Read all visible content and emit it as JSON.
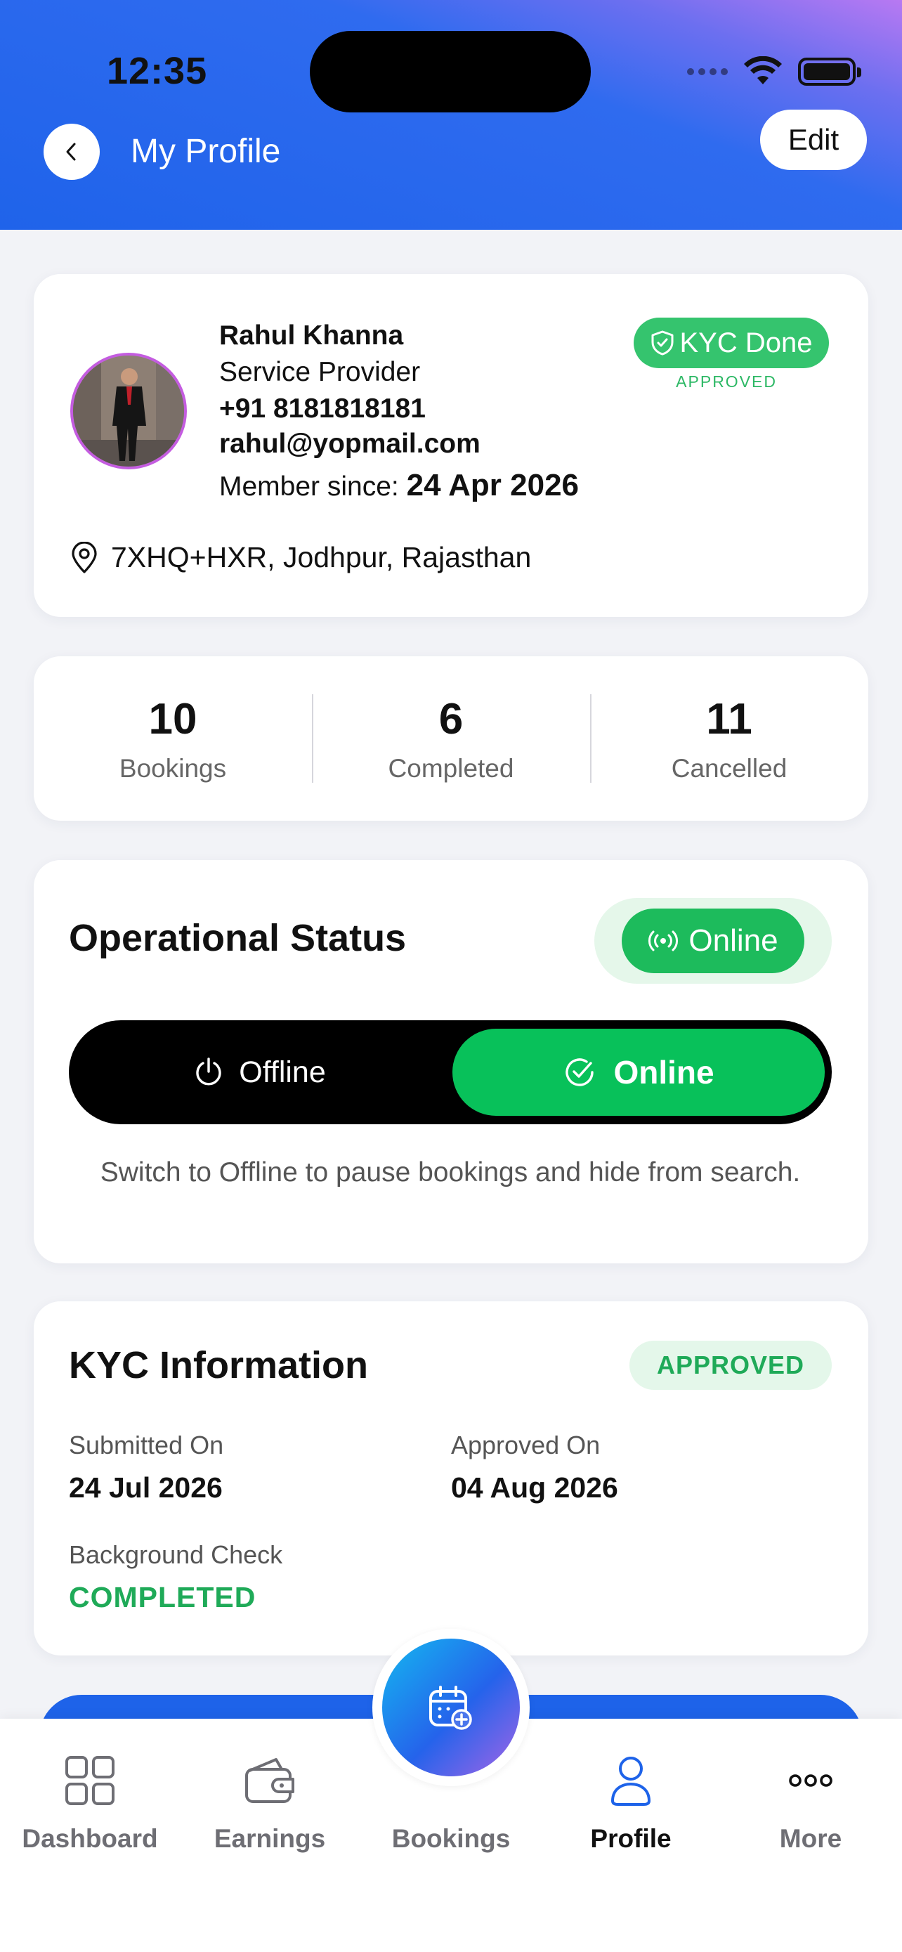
{
  "status_bar": {
    "time": "12:35"
  },
  "header": {
    "title": "My Profile",
    "edit_label": "Edit"
  },
  "profile": {
    "name": "Rahul Khanna",
    "role": "Service Provider",
    "phone": "+91 8181818181",
    "email": "rahul@yopmail.com",
    "member_since_label": "Member since:",
    "member_since_date": "24 Apr 2026",
    "kyc_badge": "KYC Done",
    "kyc_sub": "APPROVED",
    "address": "7XHQ+HXR, Jodhpur, Rajasthan"
  },
  "stats": [
    {
      "value": "10",
      "label": "Bookings"
    },
    {
      "value": "6",
      "label": "Completed"
    },
    {
      "value": "11",
      "label": "Cancelled"
    }
  ],
  "operational": {
    "title": "Operational Status",
    "badge": "Online",
    "toggle_off": "Offline",
    "toggle_on": "Online",
    "selected": "Online",
    "hint": "Switch to Offline to pause bookings and hide from search."
  },
  "kyc": {
    "title": "KYC Information",
    "status": "APPROVED",
    "submitted_label": "Submitted On",
    "submitted_value": "24 Jul 2026",
    "approved_label": "Approved On",
    "approved_value": "04 Aug 2026",
    "bg_label": "Background Check",
    "bg_value": "COMPLETED"
  },
  "tabs": [
    {
      "label": "Dashboard",
      "icon": "grid-icon",
      "active": false
    },
    {
      "label": "Earnings",
      "icon": "wallet-icon",
      "active": false
    },
    {
      "label": "Bookings",
      "icon": "calendar-add-icon",
      "active": false
    },
    {
      "label": "Profile",
      "icon": "user-icon",
      "active": true
    },
    {
      "label": "More",
      "icon": "more-icon",
      "active": false
    }
  ],
  "colors": {
    "header_blue": "#1f63ea",
    "success_green": "#08c15a",
    "kyc_green": "#35c46e",
    "accent_purple": "#b879f2"
  }
}
